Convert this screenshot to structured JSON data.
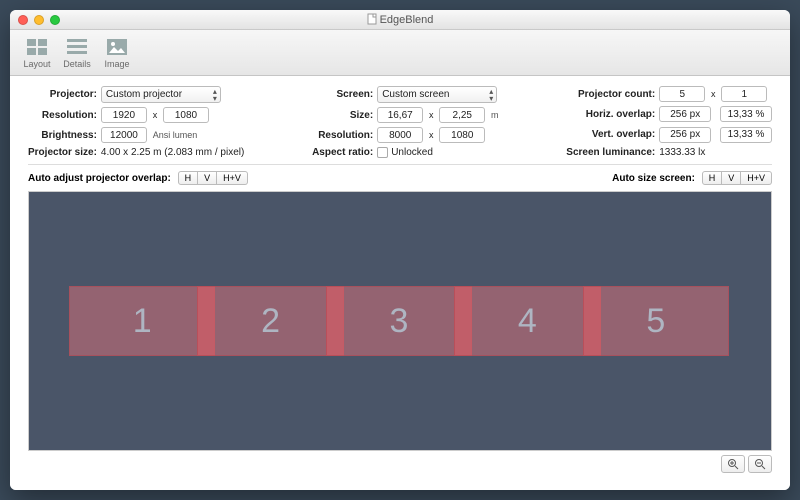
{
  "window": {
    "title": "EdgeBlend"
  },
  "toolbar": {
    "layout": "Layout",
    "details": "Details",
    "image": "Image"
  },
  "labels": {
    "projector": "Projector:",
    "resolution": "Resolution:",
    "brightness": "Brightness:",
    "projector_size": "Projector size:",
    "screen": "Screen:",
    "size": "Size:",
    "sresolution": "Resolution:",
    "aspect": "Aspect ratio:",
    "unlocked": "Unlocked",
    "pcount": "Projector count:",
    "hoverlap": "Horiz. overlap:",
    "voverlap": "Vert. overlap:",
    "luminance": "Screen luminance:",
    "auto_overlap": "Auto adjust projector overlap:",
    "auto_size": "Auto size screen:",
    "seg_h": "H",
    "seg_v": "V",
    "seg_hv": "H+V"
  },
  "values": {
    "projector_sel": "Custom projector",
    "res_w": "1920",
    "res_h": "1080",
    "brightness": "12000",
    "brightness_unit": "Ansi lumen",
    "projector_size": "4.00 x 2.25 m (2.083 mm / pixel)",
    "screen_sel": "Custom screen",
    "size_w": "16,67",
    "size_h": "2,25",
    "size_unit": "m",
    "sres_w": "8000",
    "sres_h": "1080",
    "pcount_x": "5",
    "pcount_y": "1",
    "hov_px": "256 px",
    "hov_pc": "13,33 %",
    "vov_px": "256 px",
    "vov_pc": "13,33 %",
    "luminance": "1333.33 lx"
  },
  "projectors": [
    "1",
    "2",
    "3",
    "4",
    "5"
  ]
}
